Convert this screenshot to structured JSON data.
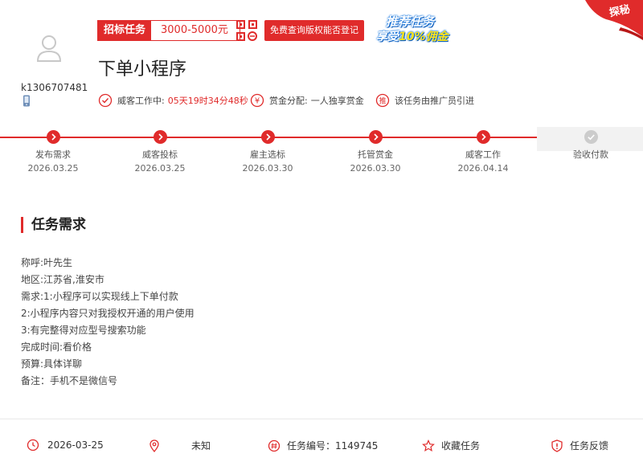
{
  "user": {
    "name": "k1306707481"
  },
  "badge": {
    "label": "招标任务",
    "value": "3000-5000元"
  },
  "check_button": "免费查询版权能否登记",
  "promo": {
    "line1": "推荐任务",
    "line2_prefix": "享受",
    "line2_highlight": "10%佣金"
  },
  "corner_label": "探秘",
  "title": "下单小程序",
  "meta": {
    "work_label": "威客工作中:",
    "work_time": "05天19时34分48秒",
    "reward_label": "赏金分配:",
    "reward_value": "一人独享赏金",
    "promoter_icon_text": "推",
    "promoter_text": "该任务由推广员引进"
  },
  "steps": [
    {
      "label": "发布需求",
      "date": "2026.03.25",
      "done": true
    },
    {
      "label": "威客投标",
      "date": "2026.03.25",
      "done": true
    },
    {
      "label": "雇主选标",
      "date": "2026.03.30",
      "done": true
    },
    {
      "label": "托管赏金",
      "date": "2026.03.30",
      "done": true
    },
    {
      "label": "威客工作",
      "date": "2026.04.14",
      "done": true
    },
    {
      "label": "验收付款",
      "date": "",
      "done": false
    }
  ],
  "section_title": "任务需求",
  "requirements": [
    "称呼:叶先生",
    "地区:江苏省,淮安市",
    "需求:1:小程序可以实现线上下单付款",
    "2:小程序内容只对我授权开通的用户使用",
    "3:有完整得对应型号搜索功能",
    "完成时间:看价格",
    "预算:具体详聊",
    "备注：手机不是微信号"
  ],
  "footer": {
    "date": "2026-03-25",
    "location": "未知",
    "task_number": "任务编号：1149745",
    "favorite": "收藏任务",
    "feedback": "任务反馈"
  },
  "colors": {
    "accent": "#e02b2b",
    "inactive": "#cccccc",
    "promo_blue": "#1577e0",
    "promo_yellow": "#ffe31a"
  },
  "icons": [
    "user-avatar-icon",
    "phone-icon",
    "qr-code-icon",
    "clock-icon",
    "yen-icon",
    "chevron-right-icon",
    "check-icon",
    "location-pin-icon",
    "hash-icon",
    "star-icon",
    "shield-alert-icon"
  ]
}
